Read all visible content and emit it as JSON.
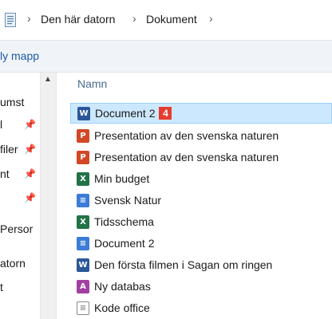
{
  "address": {
    "icon": "document-folder-icon",
    "crumbs": [
      "Den här datorn",
      "Dokument"
    ]
  },
  "toolbar": {
    "new_folder_label": "ly mapp"
  },
  "nav": {
    "items": [
      {
        "label": "umst",
        "pinned": false
      },
      {
        "label": "l",
        "pinned": true
      },
      {
        "label": "filer",
        "pinned": true
      },
      {
        "label": "nt",
        "pinned": true
      },
      {
        "label": "",
        "pinned": true
      },
      {
        "label": "Persor",
        "pinned": false
      },
      {
        "label": "atorn",
        "pinned": false
      },
      {
        "label": "t",
        "pinned": false
      }
    ]
  },
  "list": {
    "column_name": "Namn",
    "files": [
      {
        "name": "Document 2",
        "type": "word",
        "icon": "word-icon",
        "selected": true,
        "badge": "4"
      },
      {
        "name": "Presentation av den svenska naturen",
        "type": "ppt",
        "icon": "powerpoint-icon"
      },
      {
        "name": "Presentation av den svenska naturen",
        "type": "ppt",
        "icon": "powerpoint-icon"
      },
      {
        "name": "Min budget",
        "type": "excel",
        "icon": "excel-icon"
      },
      {
        "name": "Svensk Natur",
        "type": "docs",
        "icon": "google-docs-icon"
      },
      {
        "name": "Tidsschema",
        "type": "excel",
        "icon": "excel-icon"
      },
      {
        "name": "Document 2",
        "type": "docs",
        "icon": "google-docs-icon"
      },
      {
        "name": "Den första filmen i Sagan om ringen",
        "type": "word",
        "icon": "word-icon"
      },
      {
        "name": "Ny databas",
        "type": "access",
        "icon": "access-icon"
      },
      {
        "name": "Kode office",
        "type": "txt",
        "icon": "text-file-icon"
      }
    ]
  },
  "colors": {
    "selection_bg": "#cce8ff",
    "badge": "#e63c2f",
    "word": "#2b579a",
    "powerpoint": "#d24726",
    "excel": "#217346"
  }
}
